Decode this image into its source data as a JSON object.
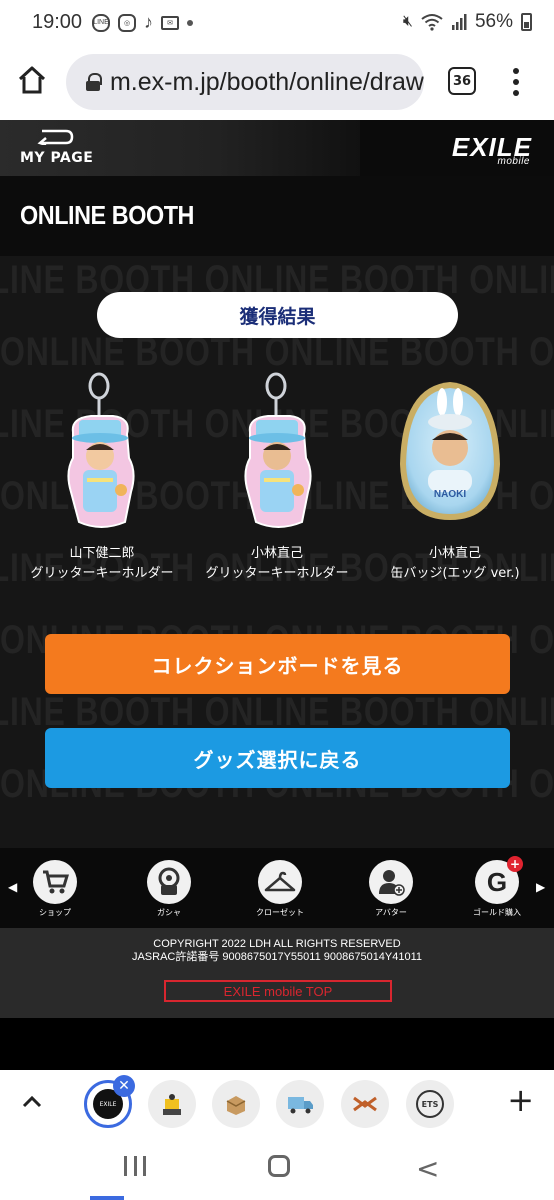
{
  "status_bar": {
    "time": "19:00",
    "notif_icons": [
      "line-icon",
      "instagram-icon",
      "tiktok-icon",
      "mail-icon",
      "dot-icon"
    ],
    "line_label": "LINE",
    "battery": "56%"
  },
  "browser": {
    "url": "m.ex-m.jp/booth/online/draw",
    "tab_count": "36"
  },
  "header": {
    "back_label": "MY PAGE",
    "logo_text": "EXILE",
    "logo_sub": "mobile"
  },
  "page": {
    "title": "ONLINE BOOTH",
    "bg_text": "ONLINE BOOTH",
    "result_title": "獲得結果",
    "egg_name": "NAOKI"
  },
  "items": [
    {
      "name_line1": "山下健二郎",
      "name_line2": "グリッターキーホルダー"
    },
    {
      "name_line1": "小林直己",
      "name_line2": "グリッターキーホルダー"
    },
    {
      "name_line1": "小林直己",
      "name_line2": "缶バッジ(エッグ ver.)"
    }
  ],
  "buttons": {
    "collection": "コレクションボードを見る",
    "back_to_goods": "グッズ選択に戻る"
  },
  "bottom_nav": [
    {
      "label": "ショップ",
      "icon": "cart-icon"
    },
    {
      "label": "ガシャ",
      "icon": "gacha-icon"
    },
    {
      "label": "クローゼット",
      "icon": "hanger-icon"
    },
    {
      "label": "アバター",
      "icon": "avatar-icon"
    },
    {
      "label": "ゴールド購入",
      "icon": "gold-icon"
    }
  ],
  "gold_letter": "G",
  "footer": {
    "copyright": "COPYRIGHT 2022 LDH ALL RIGHTS RESERVED",
    "jasrac": "JASRAC許諾番号 9008675017Y55011 9008675014Y41011",
    "top_link": "EXILE mobile TOP"
  },
  "tab_strip": {
    "active_tab_label": "EXILE",
    "last_tab_label": "ETS"
  },
  "colors": {
    "accent_orange": "#f47a1e",
    "accent_blue": "#1c9ae2",
    "result_text": "#1b2e78",
    "link_red": "#d8262f"
  }
}
